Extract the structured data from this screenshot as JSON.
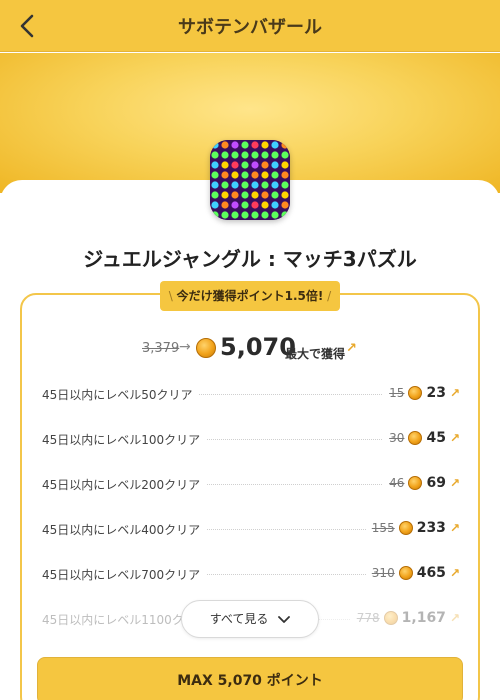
{
  "header": {
    "title": "サボテンバザール"
  },
  "app": {
    "name": "ジュエルジャングル : マッチ3パズル"
  },
  "promo": {
    "badge": "今だけ獲得ポイント1.5倍!"
  },
  "total": {
    "old_value": "3,379",
    "new_value": "5,070",
    "label": "最大で獲得"
  },
  "missions": [
    {
      "label": "45日以内にレベル50クリア",
      "old_points": "15",
      "new_points": "23"
    },
    {
      "label": "45日以内にレベル100クリア",
      "old_points": "30",
      "new_points": "45"
    },
    {
      "label": "45日以内にレベル200クリア",
      "old_points": "46",
      "new_points": "69"
    },
    {
      "label": "45日以内にレベル400クリア",
      "old_points": "155",
      "new_points": "233"
    },
    {
      "label": "45日以内にレベル700クリア",
      "old_points": "310",
      "new_points": "465"
    },
    {
      "label": "45日以内にレベル1100クリア",
      "old_points": "778",
      "new_points": "1,167"
    }
  ],
  "see_all": {
    "label": "すべて見る"
  },
  "cta": {
    "label": "MAX 5,070 ポイント"
  },
  "colors": {
    "brand": "#f5c640",
    "accent": "#e8a82a"
  },
  "icons": [
    "back-icon",
    "coin-icon",
    "external-link-icon",
    "chevron-down-icon",
    "arrow-right-icon"
  ]
}
